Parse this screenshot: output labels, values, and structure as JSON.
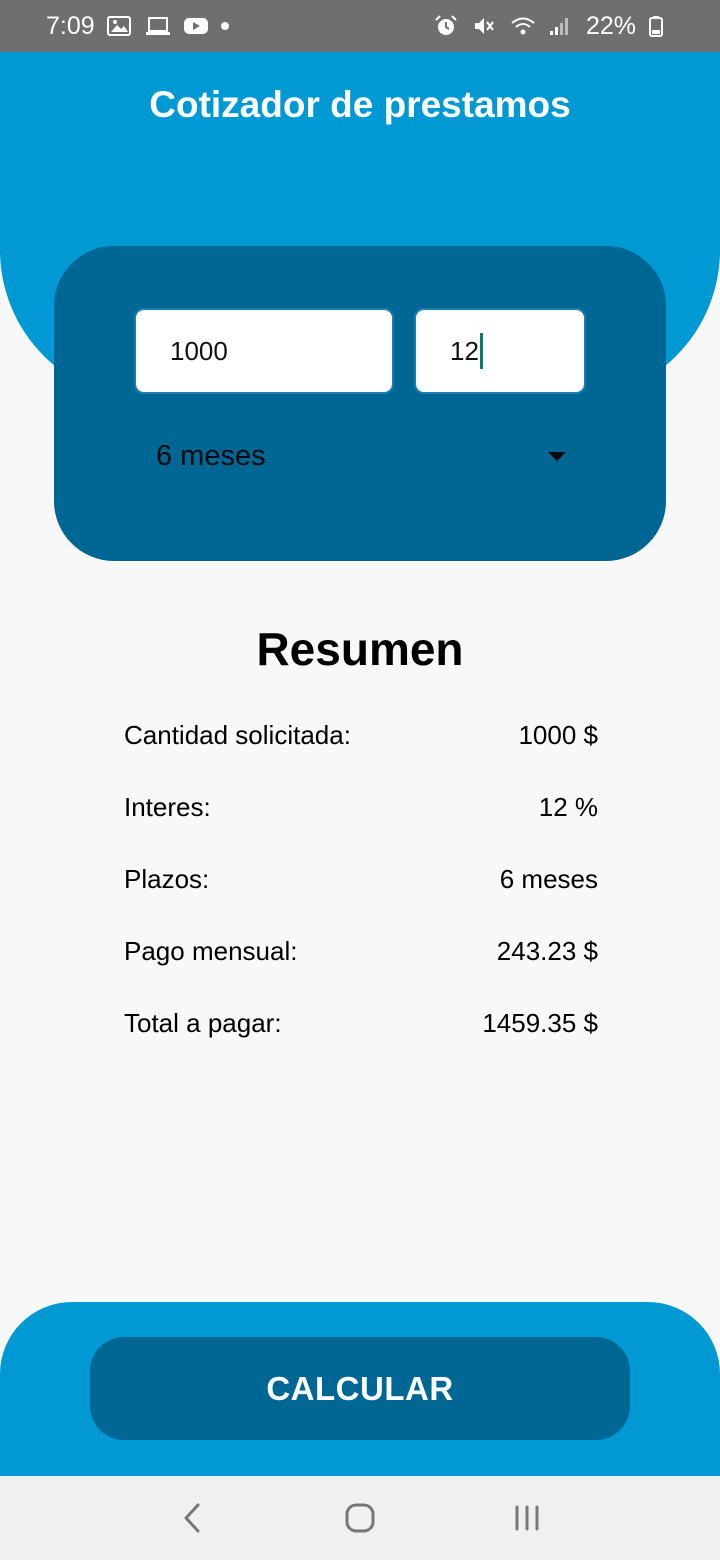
{
  "status_bar": {
    "time": "7:09",
    "battery": "22%",
    "icons_left": [
      "gallery-icon",
      "laptop-icon",
      "youtube-icon",
      "dot-icon"
    ],
    "icons_right": [
      "alarm-icon",
      "mute-icon",
      "wifi-icon",
      "signal-icon",
      "battery-icon"
    ]
  },
  "header": {
    "title": "Cotizador de prestamos"
  },
  "form": {
    "amount_value": "1000",
    "rate_value": "12",
    "term_selected": "6 meses"
  },
  "summary": {
    "title": "Resumen",
    "rows": [
      {
        "label": "Cantidad solicitada:",
        "value": "1000 $"
      },
      {
        "label": "Interes:",
        "value": "12 %"
      },
      {
        "label": "Plazos:",
        "value": "6 meses"
      },
      {
        "label": "Pago mensual:",
        "value": "243.23 $"
      },
      {
        "label": "Total a pagar:",
        "value": "1459.35 $"
      }
    ]
  },
  "actions": {
    "calculate_label": "CALCULAR"
  },
  "colors": {
    "primary": "#0099d4",
    "primary_dark": "#006694",
    "background": "#f8f8f8"
  },
  "nav": {
    "buttons": [
      "back-icon",
      "home-icon",
      "recents-icon"
    ]
  }
}
